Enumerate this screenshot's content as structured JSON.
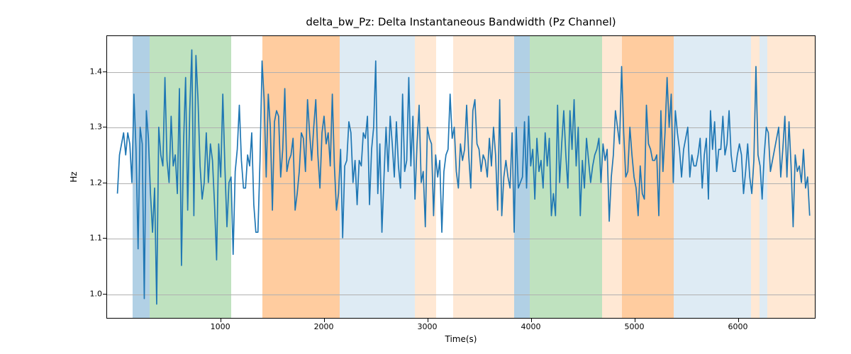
{
  "chart_data": {
    "type": "line",
    "title": "delta_bw_Pz: Delta Instantaneous Bandwidth (Pz Channel)",
    "xlabel": "Time(s)",
    "ylabel": "Hz",
    "xlim": [
      -100,
      6750
    ],
    "ylim": [
      0.955,
      1.465
    ],
    "yticks": [
      1.0,
      1.1,
      1.2,
      1.3,
      1.4
    ],
    "xticks": [
      1000,
      2000,
      3000,
      4000,
      5000,
      6000
    ],
    "spans": [
      {
        "start": 150,
        "end": 310,
        "cls": "span-blue-strong"
      },
      {
        "start": 310,
        "end": 1100,
        "cls": "span-green"
      },
      {
        "start": 1400,
        "end": 2150,
        "cls": "span-orange-strong"
      },
      {
        "start": 2150,
        "end": 2870,
        "cls": "span-blue-light"
      },
      {
        "start": 2870,
        "end": 3080,
        "cls": "span-orange-light"
      },
      {
        "start": 3240,
        "end": 3830,
        "cls": "span-orange-light"
      },
      {
        "start": 3830,
        "end": 3985,
        "cls": "span-blue-strong"
      },
      {
        "start": 3985,
        "end": 4680,
        "cls": "span-green"
      },
      {
        "start": 4680,
        "end": 4870,
        "cls": "span-orange-light"
      },
      {
        "start": 4870,
        "end": 5370,
        "cls": "span-orange-strong"
      },
      {
        "start": 5370,
        "end": 6120,
        "cls": "span-blue-light"
      },
      {
        "start": 6120,
        "end": 6200,
        "cls": "span-orange-light"
      },
      {
        "start": 6200,
        "end": 6280,
        "cls": "span-blue-light"
      },
      {
        "start": 6280,
        "end": 6750,
        "cls": "span-orange-light"
      }
    ],
    "x": [
      0,
      20,
      40,
      60,
      80,
      100,
      120,
      140,
      160,
      180,
      200,
      220,
      240,
      260,
      280,
      300,
      320,
      340,
      360,
      380,
      400,
      420,
      440,
      460,
      480,
      500,
      520,
      540,
      560,
      580,
      600,
      620,
      640,
      660,
      680,
      700,
      720,
      740,
      760,
      780,
      800,
      820,
      840,
      860,
      880,
      900,
      920,
      940,
      960,
      980,
      1000,
      1020,
      1040,
      1060,
      1080,
      1100,
      1120,
      1140,
      1160,
      1180,
      1200,
      1220,
      1240,
      1260,
      1280,
      1300,
      1320,
      1340,
      1360,
      1380,
      1400,
      1420,
      1440,
      1460,
      1480,
      1500,
      1520,
      1540,
      1560,
      1580,
      1600,
      1620,
      1640,
      1660,
      1680,
      1700,
      1720,
      1740,
      1760,
      1780,
      1800,
      1820,
      1840,
      1860,
      1880,
      1900,
      1920,
      1940,
      1960,
      1980,
      2000,
      2020,
      2040,
      2060,
      2080,
      2100,
      2120,
      2140,
      2160,
      2180,
      2200,
      2220,
      2240,
      2260,
      2280,
      2300,
      2320,
      2340,
      2360,
      2380,
      2400,
      2420,
      2440,
      2460,
      2480,
      2500,
      2520,
      2540,
      2560,
      2580,
      2600,
      2620,
      2640,
      2660,
      2680,
      2700,
      2720,
      2740,
      2760,
      2780,
      2800,
      2820,
      2840,
      2860,
      2880,
      2900,
      2920,
      2940,
      2960,
      2980,
      3000,
      3020,
      3040,
      3060,
      3080,
      3100,
      3120,
      3140,
      3160,
      3180,
      3200,
      3220,
      3240,
      3260,
      3280,
      3300,
      3320,
      3340,
      3360,
      3380,
      3400,
      3420,
      3440,
      3460,
      3480,
      3500,
      3520,
      3540,
      3560,
      3580,
      3600,
      3620,
      3640,
      3660,
      3680,
      3700,
      3720,
      3740,
      3760,
      3780,
      3800,
      3820,
      3840,
      3860,
      3880,
      3900,
      3920,
      3940,
      3960,
      3980,
      4000,
      4020,
      4040,
      4060,
      4080,
      4100,
      4120,
      4140,
      4160,
      4180,
      4200,
      4220,
      4240,
      4260,
      4280,
      4300,
      4320,
      4340,
      4360,
      4380,
      4400,
      4420,
      4440,
      4460,
      4480,
      4500,
      4520,
      4540,
      4560,
      4580,
      4600,
      4620,
      4640,
      4660,
      4680,
      4700,
      4720,
      4740,
      4760,
      4780,
      4800,
      4820,
      4840,
      4860,
      4880,
      4900,
      4920,
      4940,
      4960,
      4980,
      5000,
      5020,
      5040,
      5060,
      5080,
      5100,
      5120,
      5140,
      5160,
      5180,
      5200,
      5220,
      5240,
      5260,
      5280,
      5300,
      5320,
      5340,
      5360,
      5380,
      5400,
      5420,
      5440,
      5460,
      5480,
      5500,
      5520,
      5540,
      5560,
      5580,
      5600,
      5620,
      5640,
      5660,
      5680,
      5700,
      5720,
      5740,
      5760,
      5780,
      5800,
      5820,
      5840,
      5860,
      5880,
      5900,
      5920,
      5940,
      5960,
      5980,
      6000,
      6020,
      6040,
      6060,
      6080,
      6100,
      6120,
      6140,
      6160,
      6180,
      6200,
      6220,
      6240,
      6260,
      6280,
      6300,
      6320,
      6340,
      6360,
      6380,
      6400,
      6420,
      6440,
      6460,
      6480,
      6500,
      6520,
      6540,
      6560,
      6580,
      6600,
      6620,
      6640,
      6660,
      6680,
      6700
    ],
    "values": [
      1.18,
      1.25,
      1.27,
      1.29,
      1.25,
      1.29,
      1.27,
      1.2,
      1.36,
      1.26,
      1.08,
      1.3,
      1.27,
      0.99,
      1.33,
      1.28,
      1.18,
      1.11,
      1.19,
      0.98,
      1.3,
      1.25,
      1.23,
      1.39,
      1.24,
      1.2,
      1.32,
      1.23,
      1.25,
      1.18,
      1.37,
      1.05,
      1.27,
      1.39,
      1.15,
      1.33,
      1.44,
      1.14,
      1.43,
      1.35,
      1.23,
      1.17,
      1.2,
      1.29,
      1.2,
      1.27,
      1.24,
      1.16,
      1.06,
      1.27,
      1.21,
      1.36,
      1.23,
      1.12,
      1.2,
      1.21,
      1.07,
      1.22,
      1.26,
      1.34,
      1.24,
      1.19,
      1.19,
      1.25,
      1.23,
      1.29,
      1.16,
      1.11,
      1.11,
      1.24,
      1.42,
      1.35,
      1.21,
      1.36,
      1.3,
      1.15,
      1.31,
      1.33,
      1.32,
      1.21,
      1.26,
      1.37,
      1.22,
      1.24,
      1.25,
      1.28,
      1.15,
      1.18,
      1.22,
      1.29,
      1.28,
      1.22,
      1.35,
      1.29,
      1.24,
      1.3,
      1.35,
      1.25,
      1.19,
      1.29,
      1.32,
      1.27,
      1.29,
      1.23,
      1.36,
      1.23,
      1.15,
      1.18,
      1.26,
      1.1,
      1.23,
      1.24,
      1.31,
      1.29,
      1.2,
      1.24,
      1.16,
      1.24,
      1.23,
      1.29,
      1.28,
      1.32,
      1.16,
      1.26,
      1.3,
      1.42,
      1.18,
      1.27,
      1.11,
      1.21,
      1.3,
      1.22,
      1.32,
      1.27,
      1.21,
      1.31,
      1.23,
      1.19,
      1.36,
      1.22,
      1.24,
      1.39,
      1.23,
      1.32,
      1.17,
      1.27,
      1.34,
      1.2,
      1.22,
      1.12,
      1.3,
      1.28,
      1.27,
      1.14,
      1.25,
      1.21,
      1.24,
      1.11,
      1.22,
      1.25,
      1.26,
      1.36,
      1.28,
      1.3,
      1.22,
      1.19,
      1.27,
      1.24,
      1.26,
      1.34,
      1.25,
      1.19,
      1.33,
      1.35,
      1.27,
      1.26,
      1.22,
      1.25,
      1.24,
      1.21,
      1.28,
      1.23,
      1.3,
      1.25,
      1.15,
      1.35,
      1.14,
      1.21,
      1.24,
      1.21,
      1.19,
      1.29,
      1.11,
      1.3,
      1.19,
      1.2,
      1.21,
      1.31,
      1.19,
      1.32,
      1.23,
      1.26,
      1.17,
      1.28,
      1.22,
      1.24,
      1.19,
      1.29,
      1.23,
      1.28,
      1.14,
      1.18,
      1.14,
      1.34,
      1.2,
      1.27,
      1.33,
      1.25,
      1.19,
      1.33,
      1.26,
      1.35,
      1.23,
      1.3,
      1.14,
      1.24,
      1.19,
      1.28,
      1.24,
      1.2,
      1.23,
      1.25,
      1.26,
      1.28,
      1.2,
      1.27,
      1.24,
      1.26,
      1.13,
      1.21,
      1.25,
      1.33,
      1.3,
      1.27,
      1.41,
      1.29,
      1.21,
      1.22,
      1.3,
      1.25,
      1.21,
      1.19,
      1.14,
      1.23,
      1.18,
      1.17,
      1.34,
      1.27,
      1.26,
      1.24,
      1.24,
      1.25,
      1.14,
      1.33,
      1.22,
      1.29,
      1.39,
      1.3,
      1.36,
      1.2,
      1.33,
      1.29,
      1.26,
      1.21,
      1.26,
      1.28,
      1.3,
      1.21,
      1.25,
      1.23,
      1.23,
      1.25,
      1.28,
      1.19,
      1.25,
      1.28,
      1.17,
      1.33,
      1.26,
      1.31,
      1.22,
      1.26,
      1.26,
      1.32,
      1.25,
      1.27,
      1.33,
      1.25,
      1.22,
      1.22,
      1.25,
      1.27,
      1.25,
      1.18,
      1.22,
      1.27,
      1.21,
      1.18,
      1.24,
      1.41,
      1.25,
      1.23,
      1.17,
      1.25,
      1.3,
      1.29,
      1.22,
      1.24,
      1.26,
      1.28,
      1.3,
      1.21,
      1.26,
      1.32,
      1.21,
      1.31,
      1.23,
      1.12,
      1.25,
      1.22,
      1.23,
      1.2,
      1.26,
      1.19,
      1.21,
      1.14
    ]
  }
}
